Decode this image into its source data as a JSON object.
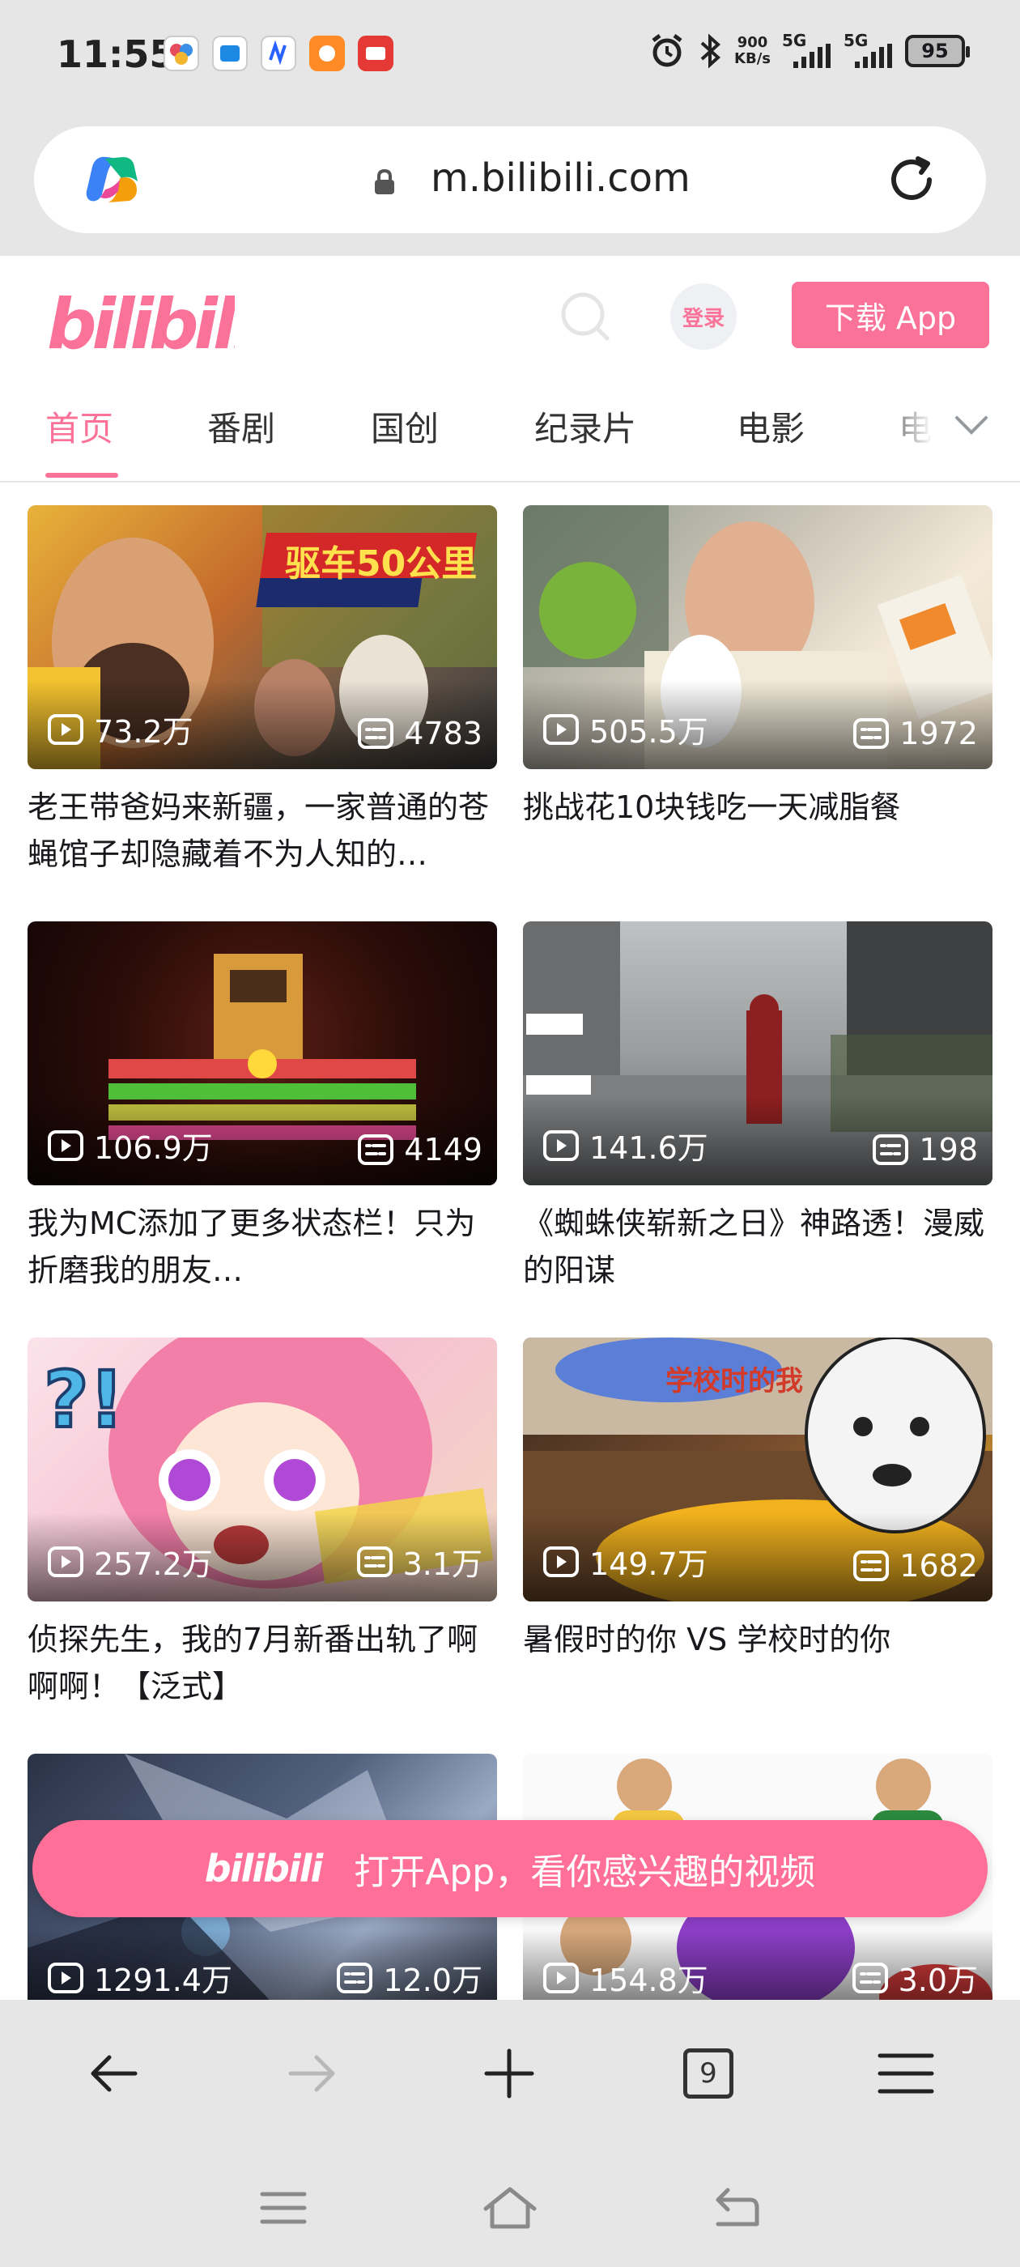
{
  "status_bar": {
    "time": "11:55",
    "net_speed_value": "900",
    "net_speed_unit": "KB/s",
    "sim1": "5G",
    "sim2": "5G",
    "battery": "95"
  },
  "url_bar": {
    "url": "m.bilibili.com"
  },
  "header": {
    "logo_text": "bilibili",
    "login_label": "登录",
    "download_label": "下载 App"
  },
  "tabs": [
    {
      "label": "首页",
      "active": true
    },
    {
      "label": "番剧"
    },
    {
      "label": "国创"
    },
    {
      "label": "纪录片"
    },
    {
      "label": "电影"
    },
    {
      "label": "电"
    }
  ],
  "videos": [
    {
      "plays": "73.2万",
      "danmaku": "4783",
      "title": "老王带爸妈来新疆，一家普通的苍蝇馆子却隐藏着不为人知的…",
      "overlay_text": "驱车50公里"
    },
    {
      "plays": "505.5万",
      "danmaku": "1972",
      "title": "挑战花10块钱吃一天减脂餐"
    },
    {
      "plays": "106.9万",
      "danmaku": "4149",
      "title": "我为MC添加了更多状态栏！只为折磨我的朋友…"
    },
    {
      "plays": "141.6万",
      "danmaku": "198",
      "title": "《蜘蛛侠崭新之日》神路透！漫威的阳谋"
    },
    {
      "plays": "257.2万",
      "danmaku": "3.1万",
      "title": "侦探先生，我的7月新番出轨了啊啊啊！【泛式】"
    },
    {
      "plays": "149.7万",
      "danmaku": "1682",
      "title": "暑假时的你 VS 学校时的你",
      "overlay_text": "学校时的我"
    },
    {
      "plays": "1291.4万",
      "danmaku": "12.0万",
      "title": ""
    },
    {
      "plays": "154.8万",
      "danmaku": "3.0万",
      "title": ""
    }
  ],
  "open_app_banner": {
    "logo_text": "bilibili",
    "text": "打开App，看你感兴趣的视频"
  },
  "browser_toolbar": {
    "tab_count": "9"
  },
  "colors": {
    "brand_pink": "#fb7299",
    "banner_pink": "#ff6f97",
    "chrome_gray": "#e6e6e6"
  },
  "icons": {
    "status_bar": [
      "alarm-icon",
      "bluetooth-icon",
      "signal-icon",
      "battery-icon"
    ],
    "browser_toolbar": [
      "back-arrow-icon",
      "forward-arrow-icon",
      "plus-icon",
      "tabs-icon",
      "menu-icon"
    ],
    "system_nav": [
      "recents-icon",
      "home-icon",
      "back-icon"
    ]
  }
}
